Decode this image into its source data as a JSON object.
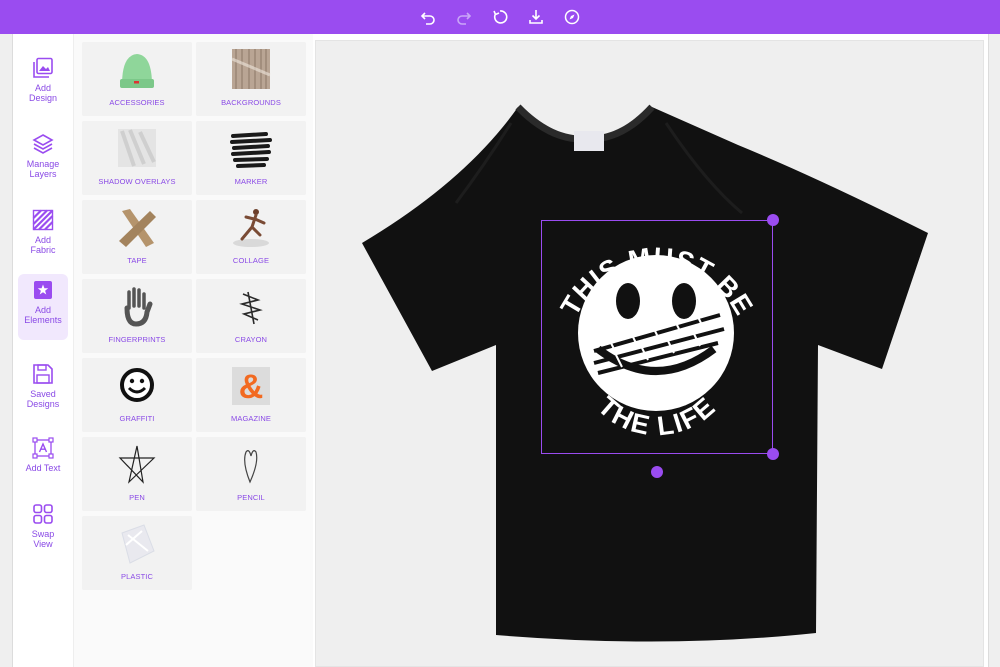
{
  "toolbar": {
    "undo": "undo-icon",
    "redo": "redo-icon",
    "reset": "reset-icon",
    "download": "download-icon",
    "explore": "compass-icon"
  },
  "sidebar": {
    "items": [
      {
        "label": "Add\nDesign",
        "icon": "image-stack-icon"
      },
      {
        "label": "Manage\nLayers",
        "icon": "layers-icon"
      },
      {
        "label": "Add\nFabric",
        "icon": "fabric-stripes-icon"
      },
      {
        "label": "Add\nElements",
        "icon": "star-square-icon",
        "active": true
      },
      {
        "label": "Saved\nDesigns",
        "icon": "save-icon"
      },
      {
        "label": "Add Text",
        "icon": "text-box-icon"
      },
      {
        "label": "Swap\nView",
        "icon": "grid-icon"
      }
    ]
  },
  "elements": {
    "categories": [
      "ACCESSORIES",
      "BACKGROUNDS",
      "SHADOW OVERLAYS",
      "MARKER",
      "TAPE",
      "COLLAGE",
      "FINGERPRINTS",
      "CRAYON",
      "GRAFFITI",
      "MAGAZINE",
      "PEN",
      "PENCIL",
      "PLASTIC"
    ]
  },
  "design": {
    "top_text": "THIS MUST BE",
    "bottom_text": "THE LIFE",
    "shirt_color": "#111111",
    "print_color": "#ffffff"
  },
  "colors": {
    "accent": "#9a4cf0",
    "label": "#8a4ae6"
  }
}
